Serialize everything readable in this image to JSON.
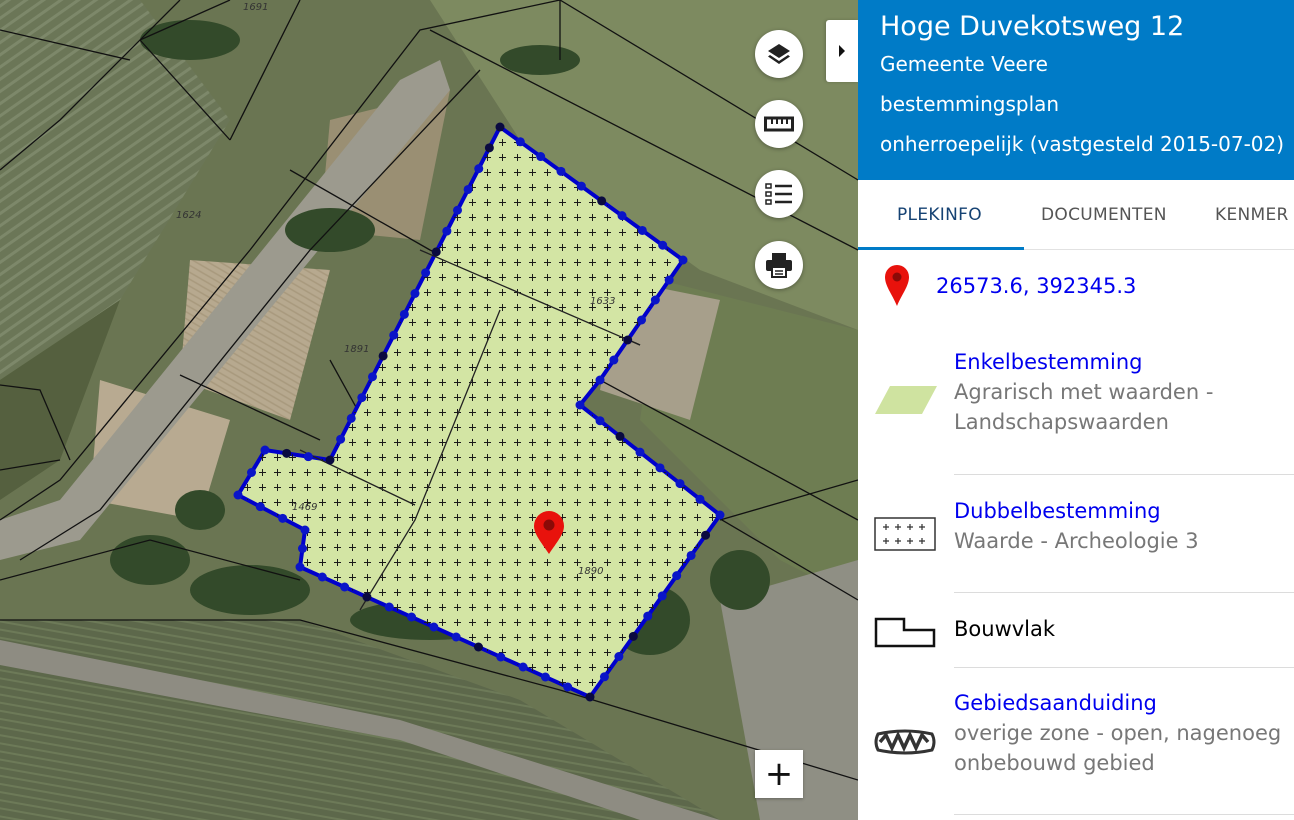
{
  "map": {
    "parcel_labels": [
      "1691",
      "1624",
      "1891",
      "1633",
      "1469",
      "1890"
    ],
    "controls": {
      "layers_icon": "layers-icon",
      "measure_icon": "ruler-icon",
      "legend_icon": "list-icon",
      "print_icon": "printer-icon",
      "zoom_in_label": "+",
      "panel_toggle_icon": "caret-right-icon"
    },
    "colors": {
      "plan_fill": "#d3e5a4",
      "plan_outline": "#0000cc",
      "marker": "#e8120c"
    }
  },
  "panel": {
    "title": "Hoge Duvekotsweg 12",
    "municipality": "Gemeente Veere",
    "plan_type": "bestemmingsplan",
    "status": "onherroepelijk (vastgesteld 2015-07-02)",
    "header_color": "#007bc7",
    "tabs": [
      "PLEKINFO",
      "DOCUMENTEN",
      "KENMER"
    ],
    "active_tab": "PLEKINFO",
    "coordinates": "26573.6, 392345.3",
    "legend": [
      {
        "title": "Enkelbestemming",
        "desc": [
          "Agrarisch met waarden -",
          "Landschapswaarden"
        ],
        "icon": "green-parallelogram-icon"
      },
      {
        "title": "Dubbelbestemming",
        "desc": [
          "Waarde - Archeologie 3"
        ],
        "icon": "plus-grid-icon"
      },
      {
        "title": "Bouwvlak",
        "desc": [],
        "icon": "building-outline-icon"
      },
      {
        "title": "Gebiedsaanduiding",
        "desc": [
          "overige zone - open, nagenoeg",
          "onbebouwd gebied"
        ],
        "icon": "zigzag-zone-icon"
      }
    ]
  }
}
